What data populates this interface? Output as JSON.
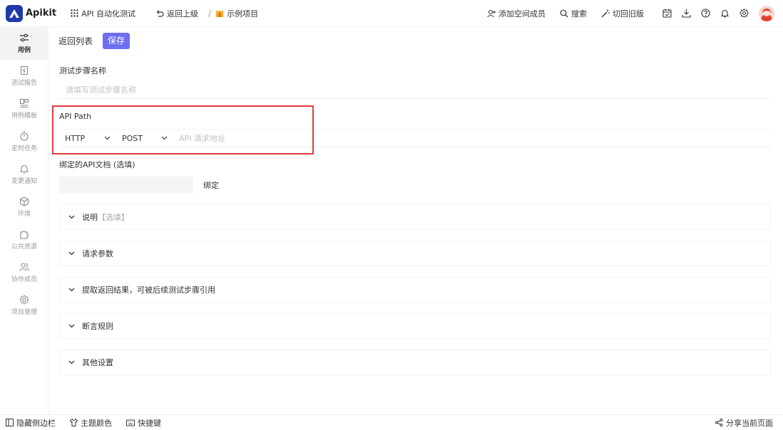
{
  "app": {
    "name": "Apikit"
  },
  "topbar": {
    "module": "API 自动化测试",
    "back": "返回上级",
    "project": "示例项目",
    "add_member": "添加空间成员",
    "search": "搜索",
    "switch_old": "切回旧版"
  },
  "sidebar": {
    "items": [
      {
        "label": "用例",
        "icon": "sliders-icon",
        "active": true
      },
      {
        "label": "测试报告",
        "icon": "report-icon"
      },
      {
        "label": "用例模板",
        "icon": "template-icon"
      },
      {
        "label": "定时任务",
        "icon": "timer-icon"
      },
      {
        "label": "变更通知",
        "icon": "bell-icon"
      },
      {
        "label": "环境",
        "icon": "cube-icon"
      },
      {
        "label": "公共资源",
        "icon": "puzzle-icon"
      },
      {
        "label": "协作成员",
        "icon": "users-icon"
      },
      {
        "label": "项目管理",
        "icon": "gear-icon"
      }
    ]
  },
  "toolbar": {
    "back_list": "返回列表",
    "save": "保存"
  },
  "form": {
    "step_name_label": "测试步骤名称",
    "step_name_placeholder": "请填写测试步骤名称",
    "api_path_label": "API Path",
    "protocol": "HTTP",
    "method": "POST",
    "path_placeholder": "API 请求地址",
    "bind_label": "绑定的API文档 (选填)",
    "bind_button": "绑定"
  },
  "sections": [
    {
      "title": "说明",
      "hint": "【选填】"
    },
    {
      "title": "请求参数",
      "hint": ""
    },
    {
      "title": "提取返回结果，可被后续测试步骤引用",
      "hint": ""
    },
    {
      "title": "断言规则",
      "hint": ""
    },
    {
      "title": "其他设置",
      "hint": ""
    }
  ],
  "bottombar": {
    "hide_sidebar": "隐藏侧边栏",
    "theme": "主题颜色",
    "shortcuts": "快捷键",
    "share": "分享当前页面"
  },
  "colors": {
    "brand": "#1f3aa8",
    "primary_button": "#6d6ef0",
    "highlight": "#e23b3b"
  }
}
